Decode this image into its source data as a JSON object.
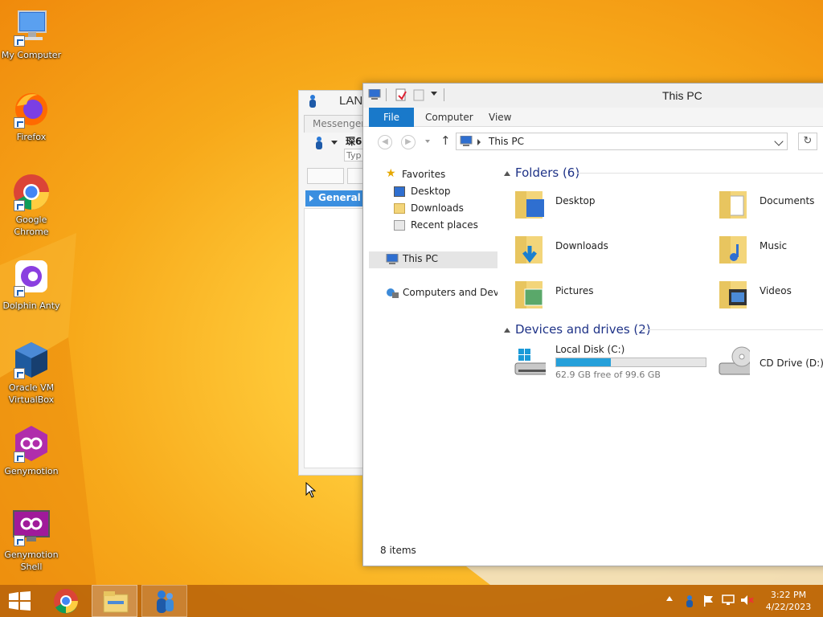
{
  "desktop": {
    "icons": [
      {
        "label": "My Computer",
        "kind": "computer-icon"
      },
      {
        "label": "Firefox",
        "kind": "firefox-icon"
      },
      {
        "label": "Google Chrome",
        "kind": "chrome-icon"
      },
      {
        "label": "Dolphin Anty",
        "kind": "dolphin-icon"
      },
      {
        "label": "Oracle VM VirtualBox",
        "kind": "virtualbox-icon"
      },
      {
        "label": "Genymotion",
        "kind": "genymotion-icon"
      },
      {
        "label": "Genymotion Shell",
        "kind": "genymotion-shell-icon"
      }
    ]
  },
  "lan": {
    "title": "LAN",
    "tab": "Messenger",
    "name": "琛6",
    "placeholder": "Typ",
    "group": "General"
  },
  "explorer": {
    "title": "This PC",
    "tabs": {
      "file": "File",
      "computer": "Computer",
      "view": "View"
    },
    "address": "This PC",
    "nav": {
      "favorites": "Favorites",
      "desktop": "Desktop",
      "downloads": "Downloads",
      "recent": "Recent places",
      "thispc": "This PC",
      "network": "Computers and Devices"
    },
    "folders_header": "Folders (6)",
    "folders": [
      {
        "name": "Desktop",
        "kind": "desktop"
      },
      {
        "name": "Documents",
        "kind": "documents"
      },
      {
        "name": "Downloads",
        "kind": "downloads"
      },
      {
        "name": "Music",
        "kind": "music"
      },
      {
        "name": "Pictures",
        "kind": "pictures"
      },
      {
        "name": "Videos",
        "kind": "videos"
      }
    ],
    "drives_header": "Devices and drives (2)",
    "local_disk": {
      "name": "Local Disk (C:)",
      "free": "62.9 GB free of 99.6 GB",
      "used_fraction": 0.368
    },
    "cd_drive": {
      "name": "CD Drive (D:)"
    },
    "status": "8 items"
  },
  "taskbar": {
    "time": "3:22 PM",
    "date": "4/22/2023"
  },
  "colors": {
    "accent": "#1979ca",
    "bar": "#26a0da",
    "folder": "#f3d57a"
  }
}
